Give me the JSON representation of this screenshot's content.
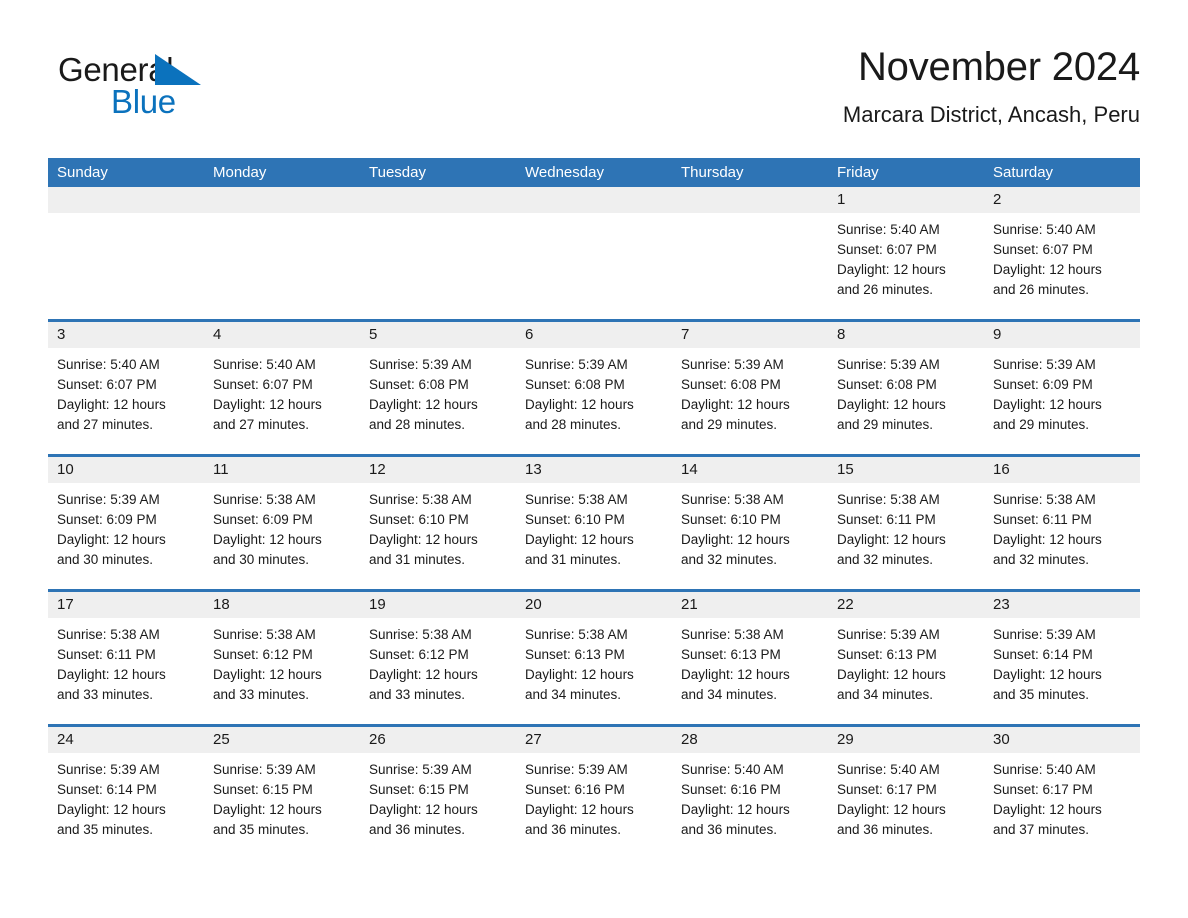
{
  "brand": {
    "name_part1": "General",
    "name_part2": "Blue",
    "triangle_color": "#0b72bd"
  },
  "header": {
    "title": "November 2024",
    "subtitle": "Marcara District, Ancash, Peru",
    "accent_color": "#2e74b5",
    "daynum_band_color": "#efefef"
  },
  "weekdays": [
    "Sunday",
    "Monday",
    "Tuesday",
    "Wednesday",
    "Thursday",
    "Friday",
    "Saturday"
  ],
  "weeks": [
    [
      {
        "empty": true
      },
      {
        "empty": true
      },
      {
        "empty": true
      },
      {
        "empty": true
      },
      {
        "empty": true
      },
      {
        "day": "1",
        "sunrise": "Sunrise: 5:40 AM",
        "sunset": "Sunset: 6:07 PM",
        "daylight_1": "Daylight: 12 hours",
        "daylight_2": "and 26 minutes."
      },
      {
        "day": "2",
        "sunrise": "Sunrise: 5:40 AM",
        "sunset": "Sunset: 6:07 PM",
        "daylight_1": "Daylight: 12 hours",
        "daylight_2": "and 26 minutes."
      }
    ],
    [
      {
        "day": "3",
        "sunrise": "Sunrise: 5:40 AM",
        "sunset": "Sunset: 6:07 PM",
        "daylight_1": "Daylight: 12 hours",
        "daylight_2": "and 27 minutes."
      },
      {
        "day": "4",
        "sunrise": "Sunrise: 5:40 AM",
        "sunset": "Sunset: 6:07 PM",
        "daylight_1": "Daylight: 12 hours",
        "daylight_2": "and 27 minutes."
      },
      {
        "day": "5",
        "sunrise": "Sunrise: 5:39 AM",
        "sunset": "Sunset: 6:08 PM",
        "daylight_1": "Daylight: 12 hours",
        "daylight_2": "and 28 minutes."
      },
      {
        "day": "6",
        "sunrise": "Sunrise: 5:39 AM",
        "sunset": "Sunset: 6:08 PM",
        "daylight_1": "Daylight: 12 hours",
        "daylight_2": "and 28 minutes."
      },
      {
        "day": "7",
        "sunrise": "Sunrise: 5:39 AM",
        "sunset": "Sunset: 6:08 PM",
        "daylight_1": "Daylight: 12 hours",
        "daylight_2": "and 29 minutes."
      },
      {
        "day": "8",
        "sunrise": "Sunrise: 5:39 AM",
        "sunset": "Sunset: 6:08 PM",
        "daylight_1": "Daylight: 12 hours",
        "daylight_2": "and 29 minutes."
      },
      {
        "day": "9",
        "sunrise": "Sunrise: 5:39 AM",
        "sunset": "Sunset: 6:09 PM",
        "daylight_1": "Daylight: 12 hours",
        "daylight_2": "and 29 minutes."
      }
    ],
    [
      {
        "day": "10",
        "sunrise": "Sunrise: 5:39 AM",
        "sunset": "Sunset: 6:09 PM",
        "daylight_1": "Daylight: 12 hours",
        "daylight_2": "and 30 minutes."
      },
      {
        "day": "11",
        "sunrise": "Sunrise: 5:38 AM",
        "sunset": "Sunset: 6:09 PM",
        "daylight_1": "Daylight: 12 hours",
        "daylight_2": "and 30 minutes."
      },
      {
        "day": "12",
        "sunrise": "Sunrise: 5:38 AM",
        "sunset": "Sunset: 6:10 PM",
        "daylight_1": "Daylight: 12 hours",
        "daylight_2": "and 31 minutes."
      },
      {
        "day": "13",
        "sunrise": "Sunrise: 5:38 AM",
        "sunset": "Sunset: 6:10 PM",
        "daylight_1": "Daylight: 12 hours",
        "daylight_2": "and 31 minutes."
      },
      {
        "day": "14",
        "sunrise": "Sunrise: 5:38 AM",
        "sunset": "Sunset: 6:10 PM",
        "daylight_1": "Daylight: 12 hours",
        "daylight_2": "and 32 minutes."
      },
      {
        "day": "15",
        "sunrise": "Sunrise: 5:38 AM",
        "sunset": "Sunset: 6:11 PM",
        "daylight_1": "Daylight: 12 hours",
        "daylight_2": "and 32 minutes."
      },
      {
        "day": "16",
        "sunrise": "Sunrise: 5:38 AM",
        "sunset": "Sunset: 6:11 PM",
        "daylight_1": "Daylight: 12 hours",
        "daylight_2": "and 32 minutes."
      }
    ],
    [
      {
        "day": "17",
        "sunrise": "Sunrise: 5:38 AM",
        "sunset": "Sunset: 6:11 PM",
        "daylight_1": "Daylight: 12 hours",
        "daylight_2": "and 33 minutes."
      },
      {
        "day": "18",
        "sunrise": "Sunrise: 5:38 AM",
        "sunset": "Sunset: 6:12 PM",
        "daylight_1": "Daylight: 12 hours",
        "daylight_2": "and 33 minutes."
      },
      {
        "day": "19",
        "sunrise": "Sunrise: 5:38 AM",
        "sunset": "Sunset: 6:12 PM",
        "daylight_1": "Daylight: 12 hours",
        "daylight_2": "and 33 minutes."
      },
      {
        "day": "20",
        "sunrise": "Sunrise: 5:38 AM",
        "sunset": "Sunset: 6:13 PM",
        "daylight_1": "Daylight: 12 hours",
        "daylight_2": "and 34 minutes."
      },
      {
        "day": "21",
        "sunrise": "Sunrise: 5:38 AM",
        "sunset": "Sunset: 6:13 PM",
        "daylight_1": "Daylight: 12 hours",
        "daylight_2": "and 34 minutes."
      },
      {
        "day": "22",
        "sunrise": "Sunrise: 5:39 AM",
        "sunset": "Sunset: 6:13 PM",
        "daylight_1": "Daylight: 12 hours",
        "daylight_2": "and 34 minutes."
      },
      {
        "day": "23",
        "sunrise": "Sunrise: 5:39 AM",
        "sunset": "Sunset: 6:14 PM",
        "daylight_1": "Daylight: 12 hours",
        "daylight_2": "and 35 minutes."
      }
    ],
    [
      {
        "day": "24",
        "sunrise": "Sunrise: 5:39 AM",
        "sunset": "Sunset: 6:14 PM",
        "daylight_1": "Daylight: 12 hours",
        "daylight_2": "and 35 minutes."
      },
      {
        "day": "25",
        "sunrise": "Sunrise: 5:39 AM",
        "sunset": "Sunset: 6:15 PM",
        "daylight_1": "Daylight: 12 hours",
        "daylight_2": "and 35 minutes."
      },
      {
        "day": "26",
        "sunrise": "Sunrise: 5:39 AM",
        "sunset": "Sunset: 6:15 PM",
        "daylight_1": "Daylight: 12 hours",
        "daylight_2": "and 36 minutes."
      },
      {
        "day": "27",
        "sunrise": "Sunrise: 5:39 AM",
        "sunset": "Sunset: 6:16 PM",
        "daylight_1": "Daylight: 12 hours",
        "daylight_2": "and 36 minutes."
      },
      {
        "day": "28",
        "sunrise": "Sunrise: 5:40 AM",
        "sunset": "Sunset: 6:16 PM",
        "daylight_1": "Daylight: 12 hours",
        "daylight_2": "and 36 minutes."
      },
      {
        "day": "29",
        "sunrise": "Sunrise: 5:40 AM",
        "sunset": "Sunset: 6:17 PM",
        "daylight_1": "Daylight: 12 hours",
        "daylight_2": "and 36 minutes."
      },
      {
        "day": "30",
        "sunrise": "Sunrise: 5:40 AM",
        "sunset": "Sunset: 6:17 PM",
        "daylight_1": "Daylight: 12 hours",
        "daylight_2": "and 37 minutes."
      }
    ]
  ]
}
